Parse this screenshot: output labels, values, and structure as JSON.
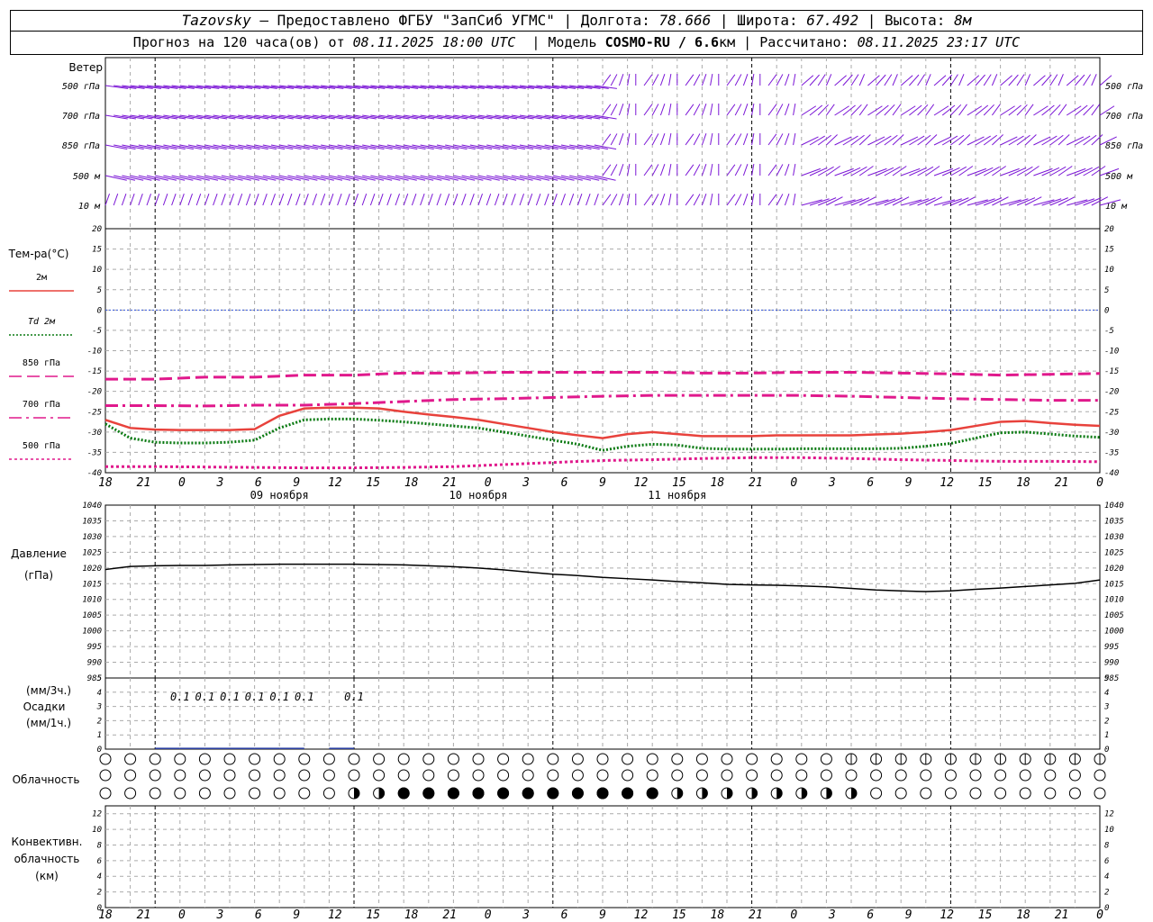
{
  "header": {
    "station": "Tazovsky",
    "provided": "– Предоставлено ФГБУ \"ЗапСиб УГМС\"",
    "lon_label": "Долгота:",
    "lon": "78.666",
    "lat_label": "Широта:",
    "lat": "67.492",
    "alt_label": "Высота:",
    "alt": "8м",
    "forecast_prefix": "Прогноз на 120 часа(ов) от",
    "forecast_from": "08.11.2025 18:00 UTC",
    "model_label": "Модель",
    "model": "COSMO-RU / 6.6",
    "model_unit": "км",
    "computed_label": "Рассчитано:",
    "computed": "08.11.2025 23:17 UTC"
  },
  "time_axis": {
    "hour_labels": [
      "18",
      "21",
      "0",
      "3",
      "6",
      "9",
      "12",
      "15",
      "18",
      "21",
      "0",
      "3",
      "6",
      "9",
      "12",
      "15",
      "18",
      "21",
      "0",
      "3",
      "6",
      "9",
      "12",
      "15",
      "18",
      "21",
      "0"
    ],
    "day_labels": [
      "09 ноября",
      "10 ноября",
      "11 ноября"
    ]
  },
  "wind_panel": {
    "title": "Ветер",
    "levels": [
      "500 гПа",
      "700 гПа",
      "850 гПа",
      "500 м",
      "10 м"
    ],
    "color": "#7b16d6"
  },
  "temp_panel": {
    "title": "Тем-ра(°С)",
    "legend": [
      {
        "label": "2м",
        "color": "#e8423c",
        "style": "solid"
      },
      {
        "label_prefix": "Td",
        "label": "2м",
        "color": "#0a7a12",
        "style": "dotted"
      },
      {
        "label": "850 гПа",
        "color": "#e0198c",
        "style": "dash"
      },
      {
        "label": "700 гПа",
        "color": "#e0198c",
        "style": "dashdot"
      },
      {
        "label": "500 гПа",
        "color": "#e0198c",
        "style": "dot"
      }
    ],
    "yticks": [
      "20",
      "15",
      "10",
      "5",
      "0",
      "-5",
      "-10",
      "-15",
      "-20",
      "-25",
      "-30",
      "-35",
      "-40"
    ]
  },
  "pressure_panel": {
    "title": "Давление",
    "unit": "(гПа)",
    "yticks": [
      "1040",
      "1035",
      "1030",
      "1025",
      "1020",
      "1015",
      "1010",
      "1005",
      "1000",
      "995",
      "990",
      "985"
    ]
  },
  "precip_panel": {
    "unit_top": "(мм/3ч.)",
    "title": "Осадки",
    "unit_bottom": "(мм/1ч.)",
    "yticks": [
      "5",
      "4",
      "3",
      "2",
      "1",
      "0"
    ],
    "annotations": [
      {
        "hour": 9,
        "text": "0.1"
      },
      {
        "hour": 12,
        "text": "0.1"
      },
      {
        "hour": 15,
        "text": "0.1"
      },
      {
        "hour": 18,
        "text": "0.1"
      },
      {
        "hour": 21,
        "text": "0.1"
      },
      {
        "hour": 24,
        "text": "0.1"
      },
      {
        "hour": 30,
        "text": "0.1"
      }
    ]
  },
  "cloud_panel": {
    "title": "Облачность"
  },
  "conv_panel": {
    "title_line1": "Конвективн.",
    "title_line2": "облачность",
    "unit": "(км)",
    "yticks": [
      "12",
      "10",
      "8",
      "6",
      "4",
      "2",
      "0"
    ]
  },
  "chart_data": [
    {
      "type": "line",
      "title": "Тем-ра(°С)",
      "x_unit": "hours from 08.11.2025 18:00 UTC",
      "ylim": [
        -40,
        20
      ],
      "series": [
        {
          "name": "2м",
          "x": [
            0,
            3,
            6,
            9,
            12,
            15,
            18,
            21,
            24,
            27,
            30,
            33,
            36,
            39,
            42,
            45,
            48,
            51,
            54,
            57,
            60,
            63,
            66,
            69,
            72,
            75,
            78,
            81,
            84,
            87,
            90,
            93,
            96,
            99,
            102,
            105,
            108,
            111,
            114,
            117,
            120
          ],
          "values": [
            -27,
            -29,
            -29.4,
            -29.5,
            -29.5,
            -29.5,
            -29.3,
            -26,
            -24.2,
            -24,
            -24,
            -24.2,
            -25,
            -25.7,
            -26.3,
            -27,
            -28,
            -29,
            -30,
            -30.8,
            -31.5,
            -30.5,
            -30,
            -30.5,
            -31,
            -31,
            -31,
            -30.8,
            -30.8,
            -30.8,
            -30.8,
            -30.6,
            -30.4,
            -30,
            -29.5,
            -28.5,
            -27.5,
            -27.3,
            -27.8,
            -28.2,
            -28.5
          ]
        },
        {
          "name": "Td 2м",
          "x": [
            0,
            3,
            6,
            9,
            12,
            15,
            18,
            21,
            24,
            27,
            30,
            33,
            36,
            39,
            42,
            45,
            48,
            51,
            54,
            57,
            60,
            63,
            66,
            69,
            72,
            75,
            78,
            81,
            84,
            87,
            90,
            93,
            96,
            99,
            102,
            105,
            108,
            111,
            114,
            117,
            120
          ],
          "values": [
            -28,
            -31.5,
            -32.5,
            -32.7,
            -32.7,
            -32.5,
            -32,
            -29,
            -27,
            -26.8,
            -26.8,
            -27.1,
            -27.5,
            -28,
            -28.5,
            -29,
            -30,
            -31,
            -32,
            -33,
            -34.5,
            -33.5,
            -33,
            -33.2,
            -34,
            -34.2,
            -34.2,
            -34.2,
            -34.1,
            -34.1,
            -34.1,
            -34.1,
            -34,
            -33.5,
            -32.8,
            -31.5,
            -30.2,
            -30,
            -30.5,
            -31,
            -31.3
          ]
        },
        {
          "name": "850 гПа",
          "x": [
            0,
            6,
            12,
            18,
            24,
            30,
            36,
            42,
            48,
            54,
            60,
            66,
            72,
            78,
            84,
            90,
            96,
            102,
            108,
            114,
            120
          ],
          "values": [
            -17,
            -17,
            -16.5,
            -16.5,
            -16,
            -16,
            -15.5,
            -15.5,
            -15.3,
            -15.3,
            -15.3,
            -15.3,
            -15.5,
            -15.5,
            -15.3,
            -15.3,
            -15.5,
            -15.7,
            -16,
            -15.8,
            -15.6
          ]
        },
        {
          "name": "700 гПа",
          "x": [
            0,
            6,
            12,
            18,
            24,
            30,
            36,
            42,
            48,
            54,
            60,
            66,
            72,
            78,
            84,
            90,
            96,
            102,
            108,
            114,
            120
          ],
          "values": [
            -23.5,
            -23.5,
            -23.6,
            -23.4,
            -23.4,
            -23,
            -22.5,
            -22,
            -21.8,
            -21.5,
            -21.2,
            -21,
            -21,
            -21,
            -21,
            -21.2,
            -21.5,
            -21.8,
            -22,
            -22.2,
            -22.2
          ]
        },
        {
          "name": "500 гПа",
          "x": [
            0,
            6,
            12,
            18,
            24,
            30,
            36,
            42,
            48,
            54,
            60,
            66,
            72,
            78,
            84,
            90,
            96,
            102,
            108,
            114,
            120
          ],
          "values": [
            -38.5,
            -38.5,
            -38.6,
            -38.7,
            -38.8,
            -38.8,
            -38.7,
            -38.5,
            -38,
            -37.5,
            -37,
            -36.8,
            -36.5,
            -36.3,
            -36.3,
            -36.5,
            -36.8,
            -37,
            -37.2,
            -37.2,
            -37.3
          ]
        }
      ]
    },
    {
      "type": "line",
      "title": "Давление",
      "ylabel": "(гПа)",
      "x_unit": "hours from 08.11.2025 18:00 UTC",
      "ylim": [
        985,
        1040
      ],
      "series": [
        {
          "x": [
            0,
            3,
            6,
            9,
            12,
            15,
            18,
            21,
            24,
            27,
            30,
            33,
            36,
            39,
            42,
            45,
            48,
            51,
            54,
            57,
            60,
            63,
            66,
            69,
            72,
            75,
            78,
            81,
            84,
            87,
            90,
            93,
            96,
            99,
            102,
            105,
            108,
            111,
            114,
            117,
            120
          ],
          "values": [
            1019.5,
            1020.5,
            1020.7,
            1020.8,
            1020.8,
            1021,
            1021.1,
            1021.2,
            1021.2,
            1021.2,
            1021.2,
            1021.1,
            1021,
            1020.7,
            1020.4,
            1020,
            1019.4,
            1018.7,
            1018,
            1017.6,
            1017,
            1016.6,
            1016.2,
            1015.7,
            1015.3,
            1014.8,
            1014.6,
            1014.5,
            1014.3,
            1014,
            1013.5,
            1013,
            1012.7,
            1012.5,
            1012.7,
            1013.2,
            1013.6,
            1014.1,
            1014.6,
            1015.1,
            1016.2
          ]
        }
      ]
    },
    {
      "type": "bar",
      "title": "Осадки",
      "x_unit": "hours from 08.11.2025 18:00 UTC",
      "ylim": [
        0,
        5
      ],
      "x": [
        9,
        12,
        15,
        18,
        21,
        24,
        30
      ],
      "values": [
        0.1,
        0.1,
        0.1,
        0.1,
        0.1,
        0.1,
        0.1
      ]
    }
  ]
}
